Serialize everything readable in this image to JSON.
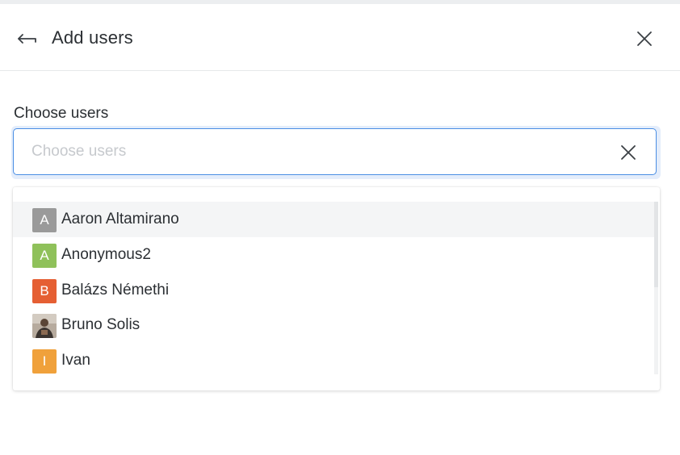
{
  "header": {
    "title": "Add users",
    "back_icon": "back-arrow-icon",
    "close_icon": "close-icon"
  },
  "field": {
    "label": "Choose users",
    "placeholder": "Choose users",
    "value": "",
    "clear_icon": "clear-icon",
    "focus_color": "#4a8ee4"
  },
  "options": [
    {
      "name": "Aaron Altamirano",
      "initial": "A",
      "color": "#9a9a9a",
      "photo": false,
      "highlighted": true
    },
    {
      "name": "Anonymous2",
      "initial": "A",
      "color": "#8fc15a",
      "photo": false,
      "highlighted": false
    },
    {
      "name": "Balázs Némethi",
      "initial": "B",
      "color": "#e55f33",
      "photo": false,
      "highlighted": false
    },
    {
      "name": "Bruno Solis",
      "initial": "",
      "color": "#6b5b4e",
      "photo": true,
      "highlighted": false
    },
    {
      "name": "Ivan",
      "initial": "I",
      "color": "#f0a13b",
      "photo": false,
      "highlighted": false
    }
  ]
}
